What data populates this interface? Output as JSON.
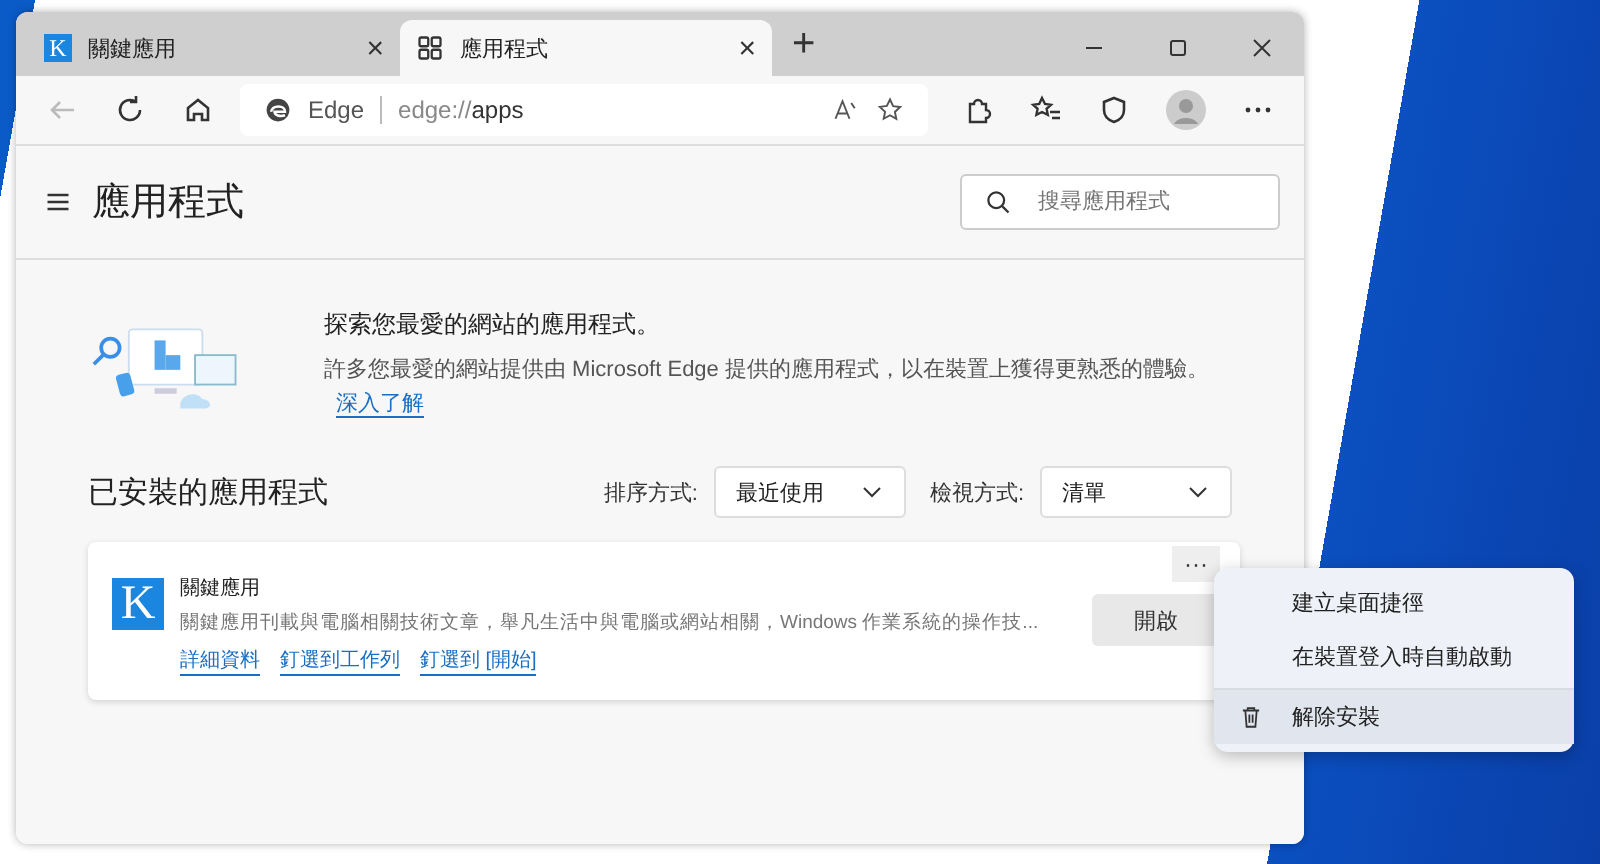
{
  "tabs": [
    {
      "kind": "site",
      "logo": "K",
      "title": "關鍵應用",
      "close": "×",
      "selected": false
    },
    {
      "kind": "apps",
      "title": "應用程式",
      "close": "×",
      "selected": true
    }
  ],
  "new_tab": "+",
  "address": {
    "site": "Edge",
    "url_prefix": "edge://",
    "url_path": "apps"
  },
  "page": {
    "title": "應用程式",
    "search_placeholder": "搜尋應用程式"
  },
  "promo": {
    "heading": "探索您最愛的網站的應用程式。",
    "body": "許多您最愛的網站提供由 Microsoft Edge 提供的應用程式，以在裝置上獲得更熟悉的體驗。",
    "link": "深入了解"
  },
  "installed": {
    "heading": "已安裝的應用程式",
    "sort_label": "排序方式:",
    "sort_value": "最近使用",
    "view_label": "檢視方式:",
    "view_value": "清單"
  },
  "apps": [
    {
      "logo": "K",
      "name": "關鍵應用",
      "description": "關鍵應用刊載與電腦相關技術文章，舉凡生活中與電腦或網站相關，Windows 作業系統的操作技...",
      "links": [
        "詳細資料",
        "釘選到工作列",
        "釘選到 [開始]"
      ],
      "open_button": "開啟",
      "more": "···"
    }
  ],
  "context_menu": [
    {
      "kind": "plain",
      "label": "建立桌面捷徑",
      "selected": false
    },
    {
      "kind": "plain",
      "label": "在裝置登入時自動啟動",
      "selected": false
    },
    {
      "kind": "uninstall",
      "label": "解除安裝",
      "selected": true
    }
  ]
}
